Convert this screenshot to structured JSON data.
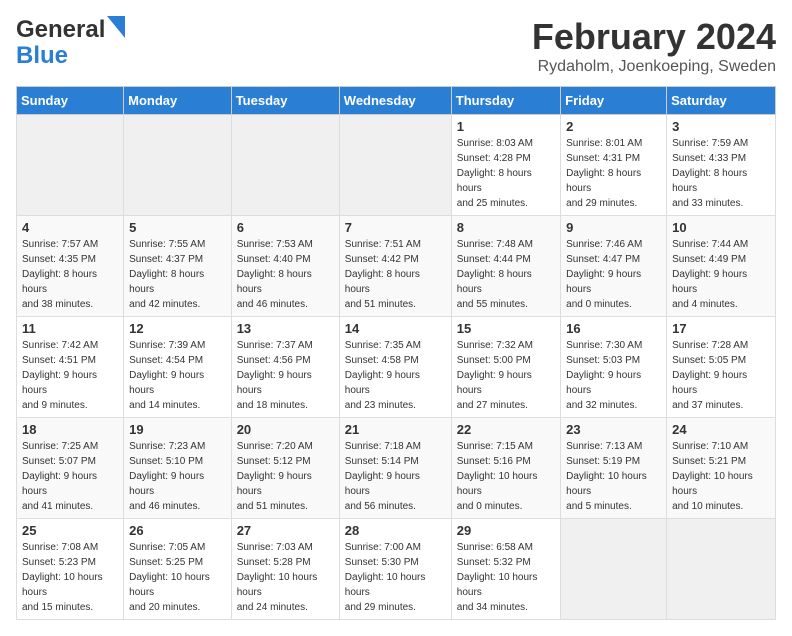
{
  "header": {
    "logo_line1": "General",
    "logo_line2": "Blue",
    "title": "February 2024",
    "subtitle": "Rydaholm, Joenkoeping, Sweden"
  },
  "days_of_week": [
    "Sunday",
    "Monday",
    "Tuesday",
    "Wednesday",
    "Thursday",
    "Friday",
    "Saturday"
  ],
  "weeks": [
    [
      {
        "day": "",
        "empty": true
      },
      {
        "day": "",
        "empty": true
      },
      {
        "day": "",
        "empty": true
      },
      {
        "day": "",
        "empty": true
      },
      {
        "day": "1",
        "sunrise": "8:03 AM",
        "sunset": "4:28 PM",
        "daylight": "8 hours and 25 minutes."
      },
      {
        "day": "2",
        "sunrise": "8:01 AM",
        "sunset": "4:31 PM",
        "daylight": "8 hours and 29 minutes."
      },
      {
        "day": "3",
        "sunrise": "7:59 AM",
        "sunset": "4:33 PM",
        "daylight": "8 hours and 33 minutes."
      }
    ],
    [
      {
        "day": "4",
        "sunrise": "7:57 AM",
        "sunset": "4:35 PM",
        "daylight": "8 hours and 38 minutes."
      },
      {
        "day": "5",
        "sunrise": "7:55 AM",
        "sunset": "4:37 PM",
        "daylight": "8 hours and 42 minutes."
      },
      {
        "day": "6",
        "sunrise": "7:53 AM",
        "sunset": "4:40 PM",
        "daylight": "8 hours and 46 minutes."
      },
      {
        "day": "7",
        "sunrise": "7:51 AM",
        "sunset": "4:42 PM",
        "daylight": "8 hours and 51 minutes."
      },
      {
        "day": "8",
        "sunrise": "7:48 AM",
        "sunset": "4:44 PM",
        "daylight": "8 hours and 55 minutes."
      },
      {
        "day": "9",
        "sunrise": "7:46 AM",
        "sunset": "4:47 PM",
        "daylight": "9 hours and 0 minutes."
      },
      {
        "day": "10",
        "sunrise": "7:44 AM",
        "sunset": "4:49 PM",
        "daylight": "9 hours and 4 minutes."
      }
    ],
    [
      {
        "day": "11",
        "sunrise": "7:42 AM",
        "sunset": "4:51 PM",
        "daylight": "9 hours and 9 minutes."
      },
      {
        "day": "12",
        "sunrise": "7:39 AM",
        "sunset": "4:54 PM",
        "daylight": "9 hours and 14 minutes."
      },
      {
        "day": "13",
        "sunrise": "7:37 AM",
        "sunset": "4:56 PM",
        "daylight": "9 hours and 18 minutes."
      },
      {
        "day": "14",
        "sunrise": "7:35 AM",
        "sunset": "4:58 PM",
        "daylight": "9 hours and 23 minutes."
      },
      {
        "day": "15",
        "sunrise": "7:32 AM",
        "sunset": "5:00 PM",
        "daylight": "9 hours and 27 minutes."
      },
      {
        "day": "16",
        "sunrise": "7:30 AM",
        "sunset": "5:03 PM",
        "daylight": "9 hours and 32 minutes."
      },
      {
        "day": "17",
        "sunrise": "7:28 AM",
        "sunset": "5:05 PM",
        "daylight": "9 hours and 37 minutes."
      }
    ],
    [
      {
        "day": "18",
        "sunrise": "7:25 AM",
        "sunset": "5:07 PM",
        "daylight": "9 hours and 41 minutes."
      },
      {
        "day": "19",
        "sunrise": "7:23 AM",
        "sunset": "5:10 PM",
        "daylight": "9 hours and 46 minutes."
      },
      {
        "day": "20",
        "sunrise": "7:20 AM",
        "sunset": "5:12 PM",
        "daylight": "9 hours and 51 minutes."
      },
      {
        "day": "21",
        "sunrise": "7:18 AM",
        "sunset": "5:14 PM",
        "daylight": "9 hours and 56 minutes."
      },
      {
        "day": "22",
        "sunrise": "7:15 AM",
        "sunset": "5:16 PM",
        "daylight": "10 hours and 0 minutes."
      },
      {
        "day": "23",
        "sunrise": "7:13 AM",
        "sunset": "5:19 PM",
        "daylight": "10 hours and 5 minutes."
      },
      {
        "day": "24",
        "sunrise": "7:10 AM",
        "sunset": "5:21 PM",
        "daylight": "10 hours and 10 minutes."
      }
    ],
    [
      {
        "day": "25",
        "sunrise": "7:08 AM",
        "sunset": "5:23 PM",
        "daylight": "10 hours and 15 minutes."
      },
      {
        "day": "26",
        "sunrise": "7:05 AM",
        "sunset": "5:25 PM",
        "daylight": "10 hours and 20 minutes."
      },
      {
        "day": "27",
        "sunrise": "7:03 AM",
        "sunset": "5:28 PM",
        "daylight": "10 hours and 24 minutes."
      },
      {
        "day": "28",
        "sunrise": "7:00 AM",
        "sunset": "5:30 PM",
        "daylight": "10 hours and 29 minutes."
      },
      {
        "day": "29",
        "sunrise": "6:58 AM",
        "sunset": "5:32 PM",
        "daylight": "10 hours and 34 minutes."
      },
      {
        "day": "",
        "empty": true
      },
      {
        "day": "",
        "empty": true
      }
    ]
  ],
  "labels": {
    "sunrise": "Sunrise:",
    "sunset": "Sunset:",
    "daylight": "Daylight:"
  }
}
